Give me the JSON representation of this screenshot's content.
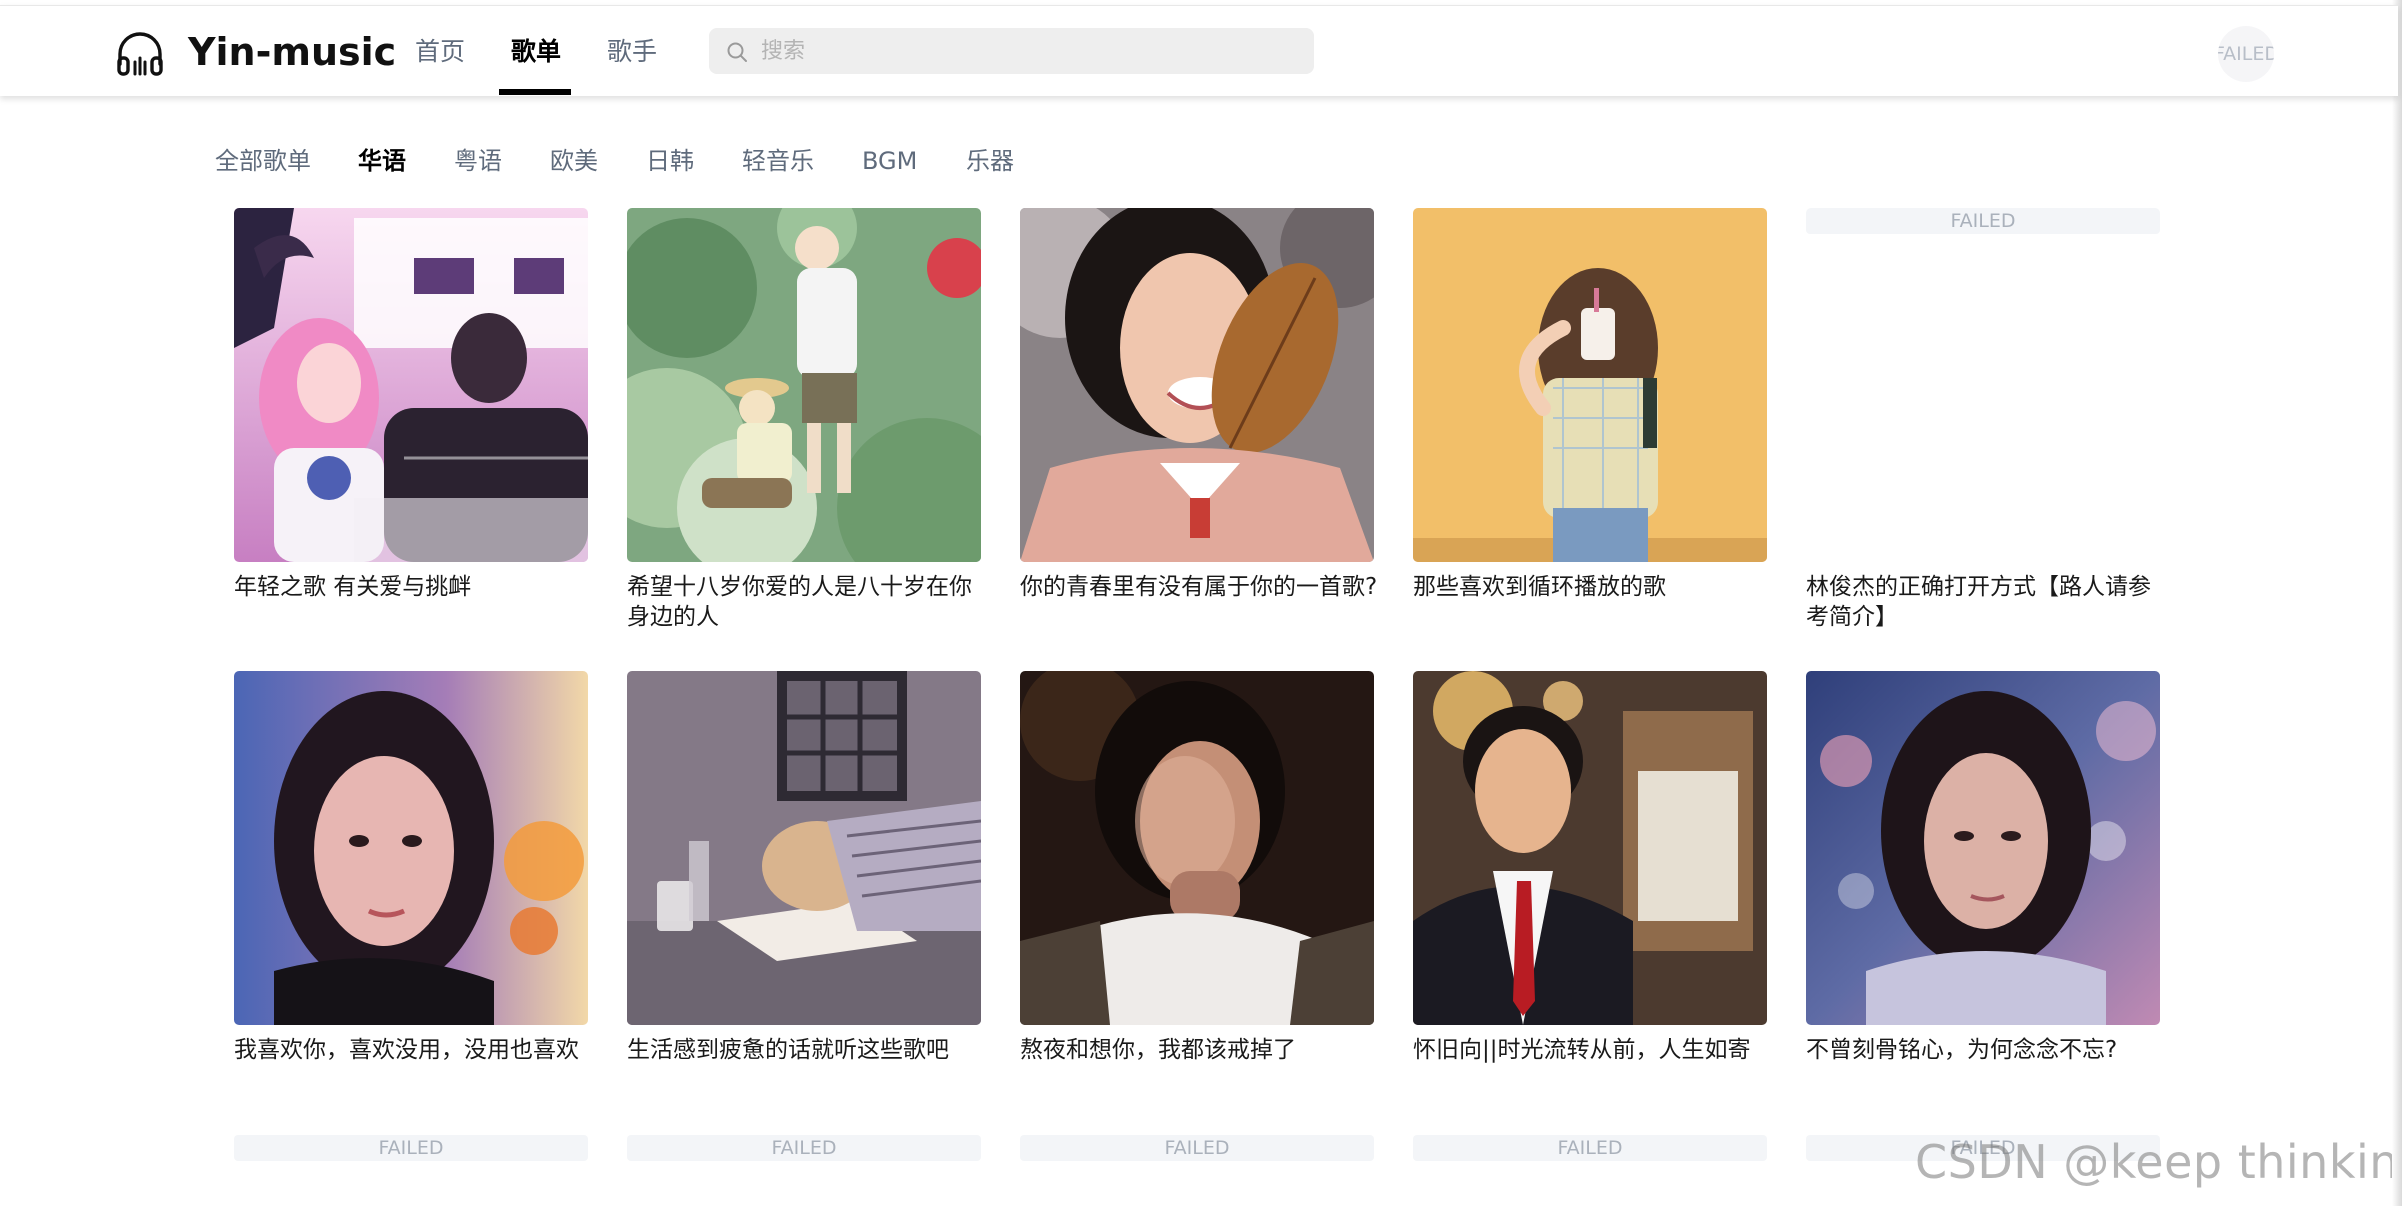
{
  "app": {
    "brand": "Yin-music",
    "logo_icon": "headphones-icon"
  },
  "nav": {
    "items": [
      {
        "label": "首页",
        "active": false
      },
      {
        "label": "歌单",
        "active": true
      },
      {
        "label": "歌手",
        "active": false
      }
    ]
  },
  "search": {
    "placeholder": "搜索",
    "value": "",
    "icon": "search-icon"
  },
  "avatar": {
    "status_text": "FAILED"
  },
  "categories": [
    {
      "label": "全部歌单",
      "active": false
    },
    {
      "label": "华语",
      "active": true
    },
    {
      "label": "粤语",
      "active": false
    },
    {
      "label": "欧美",
      "active": false
    },
    {
      "label": "日韩",
      "active": false
    },
    {
      "label": "轻音乐",
      "active": false
    },
    {
      "label": "BGM",
      "active": false
    },
    {
      "label": "乐器",
      "active": false
    }
  ],
  "playlists": [
    {
      "title": "年轻之歌 有关爱与挑衅",
      "cover": "illustration-couple-pink",
      "cover_failed": false
    },
    {
      "title": "希望十八岁你爱的人是八十岁在你身边的人",
      "cover": "illustration-garden-green",
      "cover_failed": false
    },
    {
      "title": "你的青春里有没有属于你的一首歌?",
      "cover": "photo-smiling-girl-leaf",
      "cover_failed": false
    },
    {
      "title": "那些喜欢到循环播放的歌",
      "cover": "photo-girl-yellow-wall",
      "cover_failed": false
    },
    {
      "title": "林俊杰的正确打开方式【路人请参考简介】",
      "cover": "",
      "cover_failed": true,
      "failed_text": "FAILED"
    },
    {
      "title": "我喜欢你，喜欢没用，没用也喜欢",
      "cover": "photo-girl-aquarium",
      "cover_failed": false
    },
    {
      "title": "生活感到疲惫的话就听这些歌吧",
      "cover": "illustration-sleeping-desk",
      "cover_failed": false
    },
    {
      "title": "熬夜和想你，我都该戒掉了",
      "cover": "photo-girl-dark-portrait",
      "cover_failed": false
    },
    {
      "title": "怀旧向||时光流转从前，人生如寄",
      "cover": "photo-man-suit",
      "cover_failed": false
    },
    {
      "title": "不曾刻骨铭心，为何念念不忘?",
      "cover": "photo-girl-bokeh",
      "cover_failed": false
    }
  ],
  "next_row": {
    "failed_texts": [
      "FAILED",
      "FAILED",
      "FAILED",
      "FAILED",
      "FAILED"
    ]
  },
  "watermark": "CSDN @keep   thinking",
  "colors": {
    "active_text": "#000000",
    "inactive_text": "#5f6b7c",
    "search_bg": "#eeeeee",
    "failed_text": "#aab1bb"
  }
}
